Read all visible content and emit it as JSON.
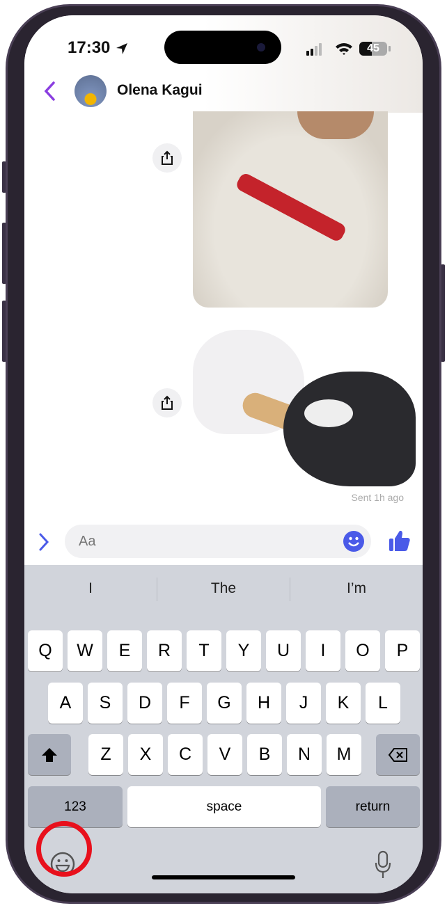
{
  "status": {
    "time": "17:30",
    "battery": "45",
    "location_icon": "location-arrow-icon",
    "signal_icon": "cellular-signal-icon",
    "wifi_icon": "wifi-icon"
  },
  "header": {
    "back_icon": "chevron-left-icon",
    "contact_name": "Olena Kagui"
  },
  "messages": [
    {
      "type": "sticker",
      "subject": "dog collar"
    },
    {
      "type": "sticker",
      "subject": "two puppies with toy"
    }
  ],
  "sent_status": "Sent 1h ago",
  "composer": {
    "placeholder": "Aa",
    "expand_icon": "chevron-right-icon",
    "emoji_icon": "smiley-icon",
    "like_icon": "thumbs-up-icon"
  },
  "keyboard": {
    "suggestions": [
      "I",
      "The",
      "I’m"
    ],
    "row1": [
      "Q",
      "W",
      "E",
      "R",
      "T",
      "Y",
      "U",
      "I",
      "O",
      "P"
    ],
    "row2": [
      "A",
      "S",
      "D",
      "F",
      "G",
      "H",
      "J",
      "K",
      "L"
    ],
    "row3": [
      "Z",
      "X",
      "C",
      "V",
      "B",
      "N",
      "M"
    ],
    "numbers": "123",
    "space": "space",
    "return": "return"
  },
  "colors": {
    "accent": "#4a5ae8",
    "back": "#8a3ee0",
    "highlight_ring": "#e8101c"
  }
}
